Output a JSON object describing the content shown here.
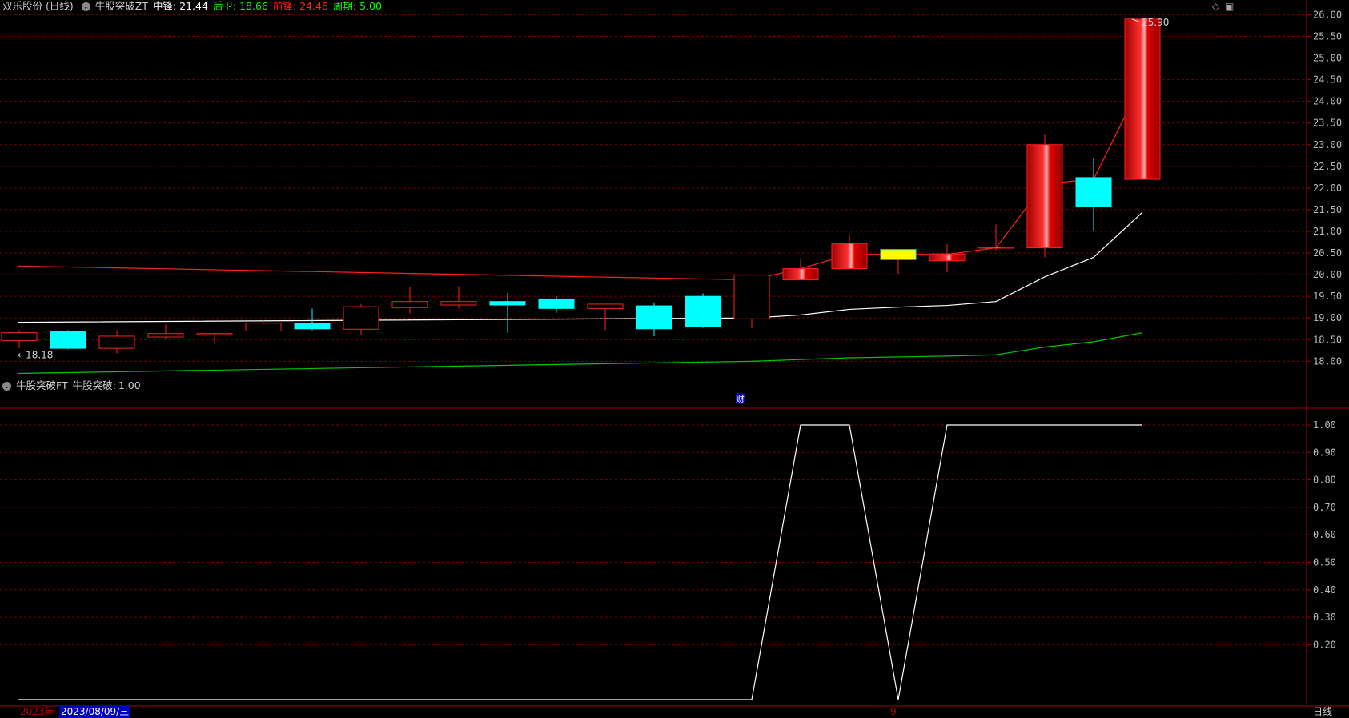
{
  "main_header": {
    "stock": "双乐股份 (日线)",
    "indicator": "牛股突破ZT",
    "items": [
      {
        "label": "中锋:",
        "value": "21.44",
        "color": "#ffffff"
      },
      {
        "label": "后卫:",
        "value": "18.66",
        "color": "#00ff00"
      },
      {
        "label": "前锋:",
        "value": "24.46",
        "color": "#ff2020"
      },
      {
        "label": "周期:",
        "value": "5.00",
        "color": "#00ff00"
      }
    ]
  },
  "sub_header": {
    "indicator": "牛股突破FT",
    "label": "牛股突破:",
    "value": "1.00"
  },
  "colors": {
    "up": "#ff2020",
    "down": "#00ffff",
    "grid": "#7a0000",
    "mid": "#ffffff",
    "back": "#00c800",
    "front": "#ff2020",
    "doji": "#ffff00"
  },
  "chart_data": [
    {
      "type": "candlestick",
      "title": "双乐股份 (日线)",
      "ylim": [
        17.6,
        26.1
      ],
      "yticks": [
        "26.00",
        "25.50",
        "25.00",
        "24.50",
        "24.00",
        "23.50",
        "23.00",
        "22.50",
        "22.00",
        "21.50",
        "21.00",
        "20.50",
        "20.00",
        "19.50",
        "19.00",
        "18.50",
        "18.00"
      ],
      "annotations": [
        {
          "text": "←18.18"
        },
        {
          "text": "25.90"
        },
        {
          "text": "财"
        }
      ],
      "candles": [
        {
          "o": 18.48,
          "h": 18.72,
          "l": 18.3,
          "c": 18.66
        },
        {
          "o": 18.7,
          "h": 18.72,
          "l": 18.28,
          "c": 18.3
        },
        {
          "o": 18.3,
          "h": 18.72,
          "l": 18.18,
          "c": 18.58
        },
        {
          "o": 18.56,
          "h": 18.85,
          "l": 18.52,
          "c": 18.64
        },
        {
          "o": 18.62,
          "h": 18.66,
          "l": 18.4,
          "c": 18.64
        },
        {
          "o": 18.7,
          "h": 18.94,
          "l": 18.7,
          "c": 18.88
        },
        {
          "o": 18.88,
          "h": 19.22,
          "l": 18.72,
          "c": 18.75
        },
        {
          "o": 18.74,
          "h": 19.32,
          "l": 18.6,
          "c": 19.26
        },
        {
          "o": 19.24,
          "h": 19.72,
          "l": 19.1,
          "c": 19.38
        },
        {
          "o": 19.3,
          "h": 19.74,
          "l": 19.22,
          "c": 19.38
        },
        {
          "o": 19.38,
          "h": 19.58,
          "l": 18.66,
          "c": 19.3
        },
        {
          "o": 19.44,
          "h": 19.5,
          "l": 19.12,
          "c": 19.22
        },
        {
          "o": 19.22,
          "h": 19.32,
          "l": 18.72,
          "c": 19.32
        },
        {
          "o": 19.28,
          "h": 19.36,
          "l": 18.58,
          "c": 18.75
        },
        {
          "o": 19.5,
          "h": 19.57,
          "l": 18.77,
          "c": 18.8
        },
        {
          "o": 18.98,
          "h": 20.0,
          "l": 18.76,
          "c": 19.99
        },
        {
          "o": 19.88,
          "h": 20.35,
          "l": 19.88,
          "c": 20.14
        },
        {
          "o": 20.14,
          "h": 20.94,
          "l": 20.14,
          "c": 20.72
        },
        {
          "o": 20.35,
          "h": 20.58,
          "l": 20.02,
          "c": 20.58
        },
        {
          "o": 20.32,
          "h": 20.7,
          "l": 20.06,
          "c": 20.48
        },
        {
          "o": 20.62,
          "h": 21.16,
          "l": 20.56,
          "c": 20.64
        },
        {
          "o": 20.62,
          "h": 23.24,
          "l": 20.4,
          "c": 23.0
        },
        {
          "o": 22.24,
          "h": 22.68,
          "l": 21.0,
          "c": 21.58
        },
        {
          "o": 22.2,
          "h": 25.9,
          "l": 22.2,
          "c": 25.9
        }
      ],
      "series": [
        {
          "name": "前锋",
          "type": "line",
          "points": [
            [
              0,
              20.2
            ],
            [
              15,
              19.88
            ],
            [
              16,
              20.14
            ],
            [
              17,
              20.47
            ],
            [
              18,
              20.47
            ],
            [
              19,
              20.47
            ],
            [
              20,
              20.62
            ],
            [
              21,
              22.1
            ],
            [
              22,
              22.2
            ],
            [
              23,
              24.46
            ]
          ]
        },
        {
          "name": "中锋",
          "type": "line",
          "points": [
            [
              0,
              18.9
            ],
            [
              15,
              19.0
            ],
            [
              16,
              19.07
            ],
            [
              17,
              19.2
            ],
            [
              18,
              19.25
            ],
            [
              19,
              19.29
            ],
            [
              20,
              19.38
            ],
            [
              21,
              19.95
            ],
            [
              22,
              20.4
            ],
            [
              23,
              21.44
            ]
          ]
        },
        {
          "name": "后卫",
          "type": "line",
          "points": [
            [
              0,
              17.72
            ],
            [
              15,
              18.0
            ],
            [
              16,
              18.04
            ],
            [
              17,
              18.08
            ],
            [
              18,
              18.1
            ],
            [
              19,
              18.12
            ],
            [
              20,
              18.15
            ],
            [
              21,
              18.33
            ],
            [
              22,
              18.45
            ],
            [
              23,
              18.66
            ]
          ]
        }
      ]
    },
    {
      "type": "line",
      "title": "牛股突破FT",
      "ylim": [
        0.0,
        1.04
      ],
      "yticks": [
        "1.00",
        "0.90",
        "0.80",
        "0.70",
        "0.60",
        "0.50",
        "0.40",
        "0.30",
        "0.20"
      ],
      "series": [
        {
          "name": "牛股突破",
          "values": [
            0,
            0,
            0,
            0,
            0,
            0,
            0,
            0,
            0,
            0,
            0,
            0,
            0,
            0,
            0,
            0,
            1,
            1,
            0,
            1,
            1,
            1,
            1,
            1
          ]
        }
      ]
    }
  ],
  "bottom_bar": {
    "year": "2023年",
    "date": "2023/08/09/三",
    "marker": "9",
    "period": "日线"
  }
}
